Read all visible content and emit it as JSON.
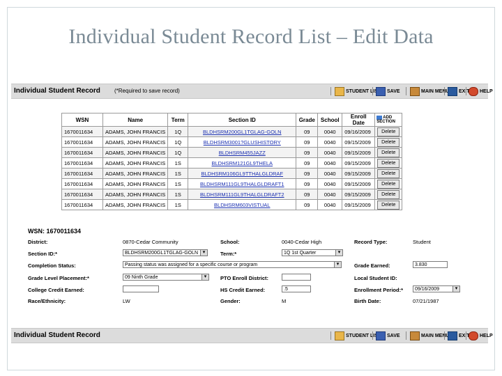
{
  "slide": {
    "title": "Individual Student Record List – Edit Data"
  },
  "toolbar": {
    "title": "Individual Student Record",
    "required_note": "(*Required to save record)",
    "buttons": {
      "student_list": "STUDENT LIST",
      "save": "SAVE",
      "main_menu": "MAIN MENU",
      "exit": "EXIT",
      "help": "HELP"
    }
  },
  "grid": {
    "headers": [
      "WSN",
      "Name",
      "Term",
      "Section ID",
      "Grade",
      "School",
      "Enroll Date"
    ],
    "add_section_label": "ADD SECTION",
    "rows": [
      {
        "wsn": "1670011634",
        "name": "ADAMS, JOHN FRANCIS",
        "term": "1Q",
        "section": "BLDHSRM200GL1TGLAG-GOLN",
        "grade": "09",
        "school": "0040",
        "date": "09/16/2009",
        "action": "Delete"
      },
      {
        "wsn": "1670011634",
        "name": "ADAMS, JOHN FRANCIS",
        "term": "1Q",
        "section": "BLDHSRM3001?GLUSHISTORY",
        "grade": "09",
        "school": "0040",
        "date": "09/15/2009",
        "action": "Delete"
      },
      {
        "wsn": "1670011634",
        "name": "ADAMS, JOHN FRANCIS",
        "term": "1Q",
        "section": "BLDHSRM455JAZZ",
        "grade": "09",
        "school": "0040",
        "date": "09/15/2009",
        "action": "Delete"
      },
      {
        "wsn": "1670011634",
        "name": "ADAMS, JOHN FRANCIS",
        "term": "1S",
        "section": "BLDHSRM121GL9THELA",
        "grade": "09",
        "school": "0040",
        "date": "09/15/2009",
        "action": "Delete"
      },
      {
        "wsn": "1670011634",
        "name": "ADAMS, JOHN FRANCIS",
        "term": "1S",
        "section": "BLDHSRM106GL9TTHALGLDRAF",
        "grade": "09",
        "school": "0040",
        "date": "09/15/2009",
        "action": "Delete"
      },
      {
        "wsn": "1670011634",
        "name": "ADAMS, JOHN FRANCIS",
        "term": "1S",
        "section": "BLDHSRM111GL9THALGLDRAFT1",
        "grade": "09",
        "school": "0040",
        "date": "09/15/2009",
        "action": "Delete"
      },
      {
        "wsn": "1670011634",
        "name": "ADAMS, JOHN FRANCIS",
        "term": "1S",
        "section": "BLDHSRM111GL9THALGLDRAFT2",
        "grade": "09",
        "school": "0040",
        "date": "09/15/2009",
        "action": "Delete"
      },
      {
        "wsn": "1670011634",
        "name": "ADAMS, JOHN FRANCIS",
        "term": "1S",
        "section": "BLDHSRM603VISTUAL",
        "grade": "09",
        "school": "0040",
        "date": "09/15/2009",
        "action": "Delete"
      }
    ]
  },
  "detail": {
    "wsn_heading": "WSN: 1670011634",
    "district_label": "District:",
    "district_value": "0870-Cedar Community",
    "school_label": "School:",
    "school_value": "0040-Cedar High",
    "record_type_label": "Record Type:",
    "record_type_value": "Student",
    "section_id_label": "Section ID:*",
    "section_id_value": "BLDHSRM200GL1TGLAG-GOLN",
    "term_label": "Term:*",
    "term_value": "1Q 1st Quarter",
    "completion_label": "Completion Status:",
    "completion_value": "Passing status was assigned for a specific course or program",
    "grade_earned_label": "Grade Earned:",
    "grade_earned_value": "3.830",
    "grade_level_label": "Grade Level Placement:*",
    "grade_level_value": "09 Ninth Grade",
    "pto_label": "PTO Enroll District:",
    "pto_value": "",
    "local_id_label": "Local Student ID:",
    "local_id_value": "",
    "college_label": "College Credit Earned:",
    "college_value": "",
    "hs_credit_label": "HS Credit Earned:",
    "hs_credit_value": ".5",
    "enroll_period_label": "Enrollment Period:*",
    "enroll_period_value": "09/16/2009",
    "race_label": "Race/Ethnicity:",
    "race_value": "LW",
    "gender_label": "Gender:",
    "gender_value": "M",
    "birth_label": "Birth Date:",
    "birth_value": "07/21/1987"
  }
}
